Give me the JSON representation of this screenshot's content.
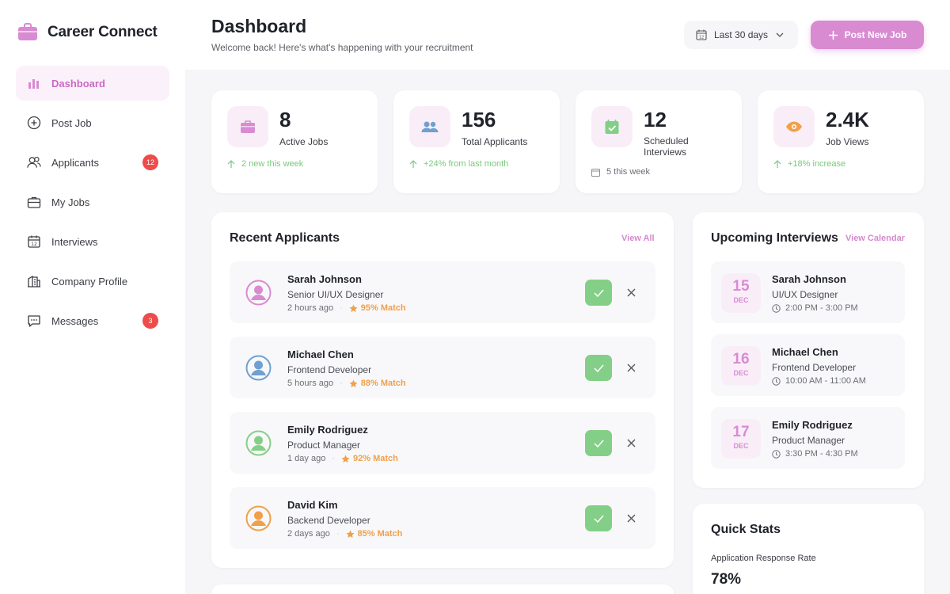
{
  "brand": {
    "name": "Career Connect",
    "icon": "briefcase-icon"
  },
  "nav": [
    {
      "label": "Dashboard",
      "icon": "bar-chart-icon",
      "active": true
    },
    {
      "label": "Post Job",
      "icon": "plus-circle-icon"
    },
    {
      "label": "Applicants",
      "icon": "users-icon",
      "badge": "12"
    },
    {
      "label": "My Jobs",
      "icon": "briefcase-icon"
    },
    {
      "label": "Interviews",
      "icon": "calendar-icon"
    },
    {
      "label": "Company Profile",
      "icon": "building-icon"
    },
    {
      "label": "Messages",
      "icon": "message-icon",
      "badge": "3"
    }
  ],
  "header": {
    "title": "Dashboard",
    "subtitle": "Welcome back! Here's what's happening with your recruitment",
    "range_label": "Last 30 days",
    "post_label": "Post New Job"
  },
  "stats": [
    {
      "value": "8",
      "label": "Active Jobs",
      "foot": "2 new this week",
      "icon": "briefcase-icon"
    },
    {
      "value": "156",
      "label": "Total Applicants",
      "foot": "+24% from last month",
      "icon": "users-icon"
    },
    {
      "value": "12",
      "label": "Scheduled Interviews",
      "foot": "5 this week",
      "icon": "calendar-check-icon"
    },
    {
      "value": "2.4K",
      "label": "Job Views",
      "foot": "+18% increase",
      "icon": "eye-icon"
    }
  ],
  "recent": {
    "title": "Recent Applicants",
    "view_all": "View All",
    "rows": [
      {
        "name": "Sarah Johnson",
        "role": "Senior UI/UX Designer",
        "time": "2 hours ago",
        "match": "95% Match",
        "color": "#d98bd2"
      },
      {
        "name": "Michael Chen",
        "role": "Frontend Developer",
        "time": "5 hours ago",
        "match": "88% Match",
        "color": "#6fa0d0"
      },
      {
        "name": "Emily Rodriguez",
        "role": "Product Manager",
        "time": "1 day ago",
        "match": "92% Match",
        "color": "#84cf87"
      },
      {
        "name": "David Kim",
        "role": "Backend Developer",
        "time": "2 days ago",
        "match": "85% Match",
        "color": "#f0a04b"
      }
    ]
  },
  "interviews": {
    "title": "Upcoming Interviews",
    "view_calendar": "View Calendar",
    "rows": [
      {
        "day": "15",
        "month": "DEC",
        "name": "Sarah Johnson",
        "role": "UI/UX Designer",
        "time": "2:00 PM - 3:00 PM"
      },
      {
        "day": "16",
        "month": "DEC",
        "name": "Michael Chen",
        "role": "Frontend Developer",
        "time": "10:00 AM - 11:00 AM"
      },
      {
        "day": "17",
        "month": "DEC",
        "name": "Emily Rodriguez",
        "role": "Product Manager",
        "time": "3:30 PM - 4:30 PM"
      }
    ]
  },
  "quick_stats": {
    "title": "Quick Stats",
    "metric_label": "Application Response Rate",
    "metric_value": "78%"
  },
  "colors": {
    "accent": "#d98bd2",
    "green": "#84cf87",
    "orange": "#f0a04b",
    "red": "#ee4b4b"
  }
}
